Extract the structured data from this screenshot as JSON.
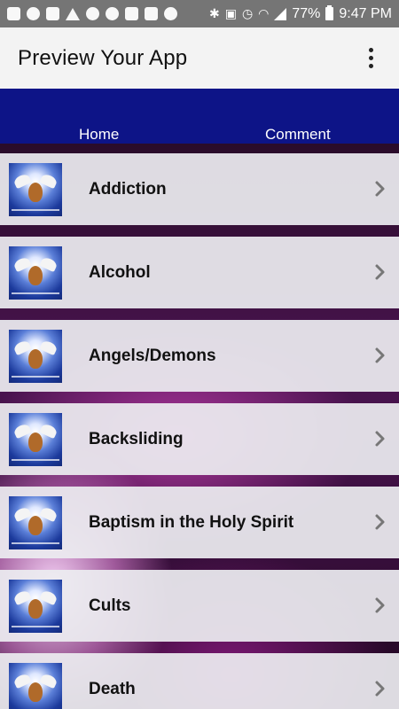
{
  "status_bar": {
    "battery": "77%",
    "time": "9:47 PM"
  },
  "app_bar": {
    "title": "Preview Your App",
    "menu_icon": "more-vert-icon"
  },
  "nav": {
    "tabs": [
      {
        "label": "Home"
      },
      {
        "label": "Comment"
      }
    ]
  },
  "topics": [
    {
      "label": "Addiction"
    },
    {
      "label": "Alcohol"
    },
    {
      "label": "Angels/Demons"
    },
    {
      "label": "Backsliding"
    },
    {
      "label": "Baptism in the Holy Spirit"
    },
    {
      "label": "Cults"
    },
    {
      "label": "Death"
    }
  ],
  "colors": {
    "nav_bar": "#0d1487",
    "app_bar": "#f3f3f3",
    "status_bar": "#757575"
  }
}
